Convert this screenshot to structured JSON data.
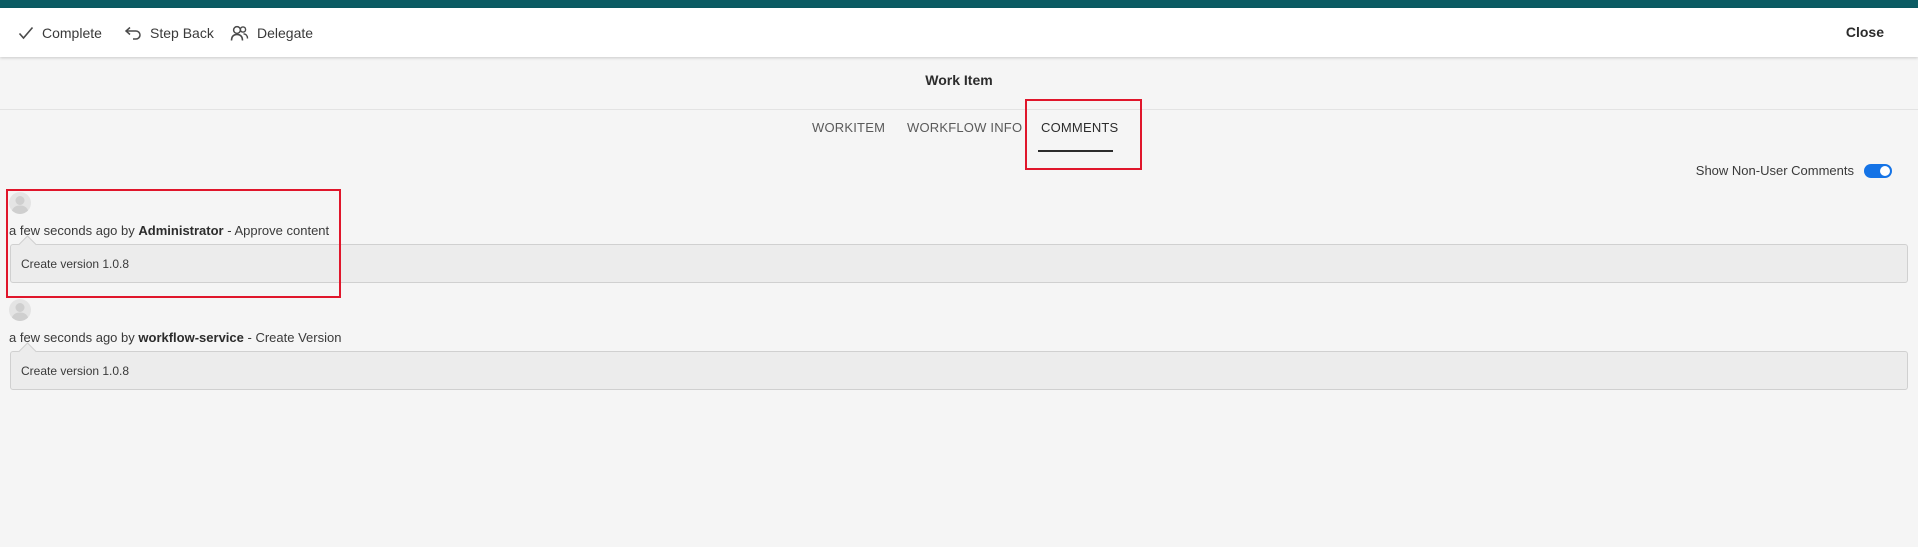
{
  "toolbar": {
    "complete_label": "Complete",
    "step_back_label": "Step Back",
    "delegate_label": "Delegate",
    "close_label": "Close"
  },
  "page": {
    "title": "Work Item"
  },
  "tabs": [
    {
      "label": "WORKITEM",
      "active": false
    },
    {
      "label": "WORKFLOW INFO",
      "active": false
    },
    {
      "label": "COMMENTS",
      "active": true
    }
  ],
  "filter": {
    "show_non_user_comments_label": "Show Non-User Comments",
    "show_non_user_comments": true
  },
  "comments": [
    {
      "time": "a few seconds ago",
      "by": "by",
      "author": "Administrator",
      "step": "- Approve content",
      "text": "Create version 1.0.8"
    },
    {
      "time": "a few seconds ago",
      "by": "by",
      "author": "workflow-service",
      "step": "- Create Version",
      "text": "Create version 1.0.8"
    }
  ],
  "colors": {
    "brand": "#0b5b63",
    "accent": "#1473e6",
    "highlight": "#e0162b"
  },
  "icons": {
    "complete": "checkmark-icon",
    "step_back": "undo-arrow-icon",
    "delegate": "user-group-icon",
    "avatar": "user-avatar-icon"
  }
}
